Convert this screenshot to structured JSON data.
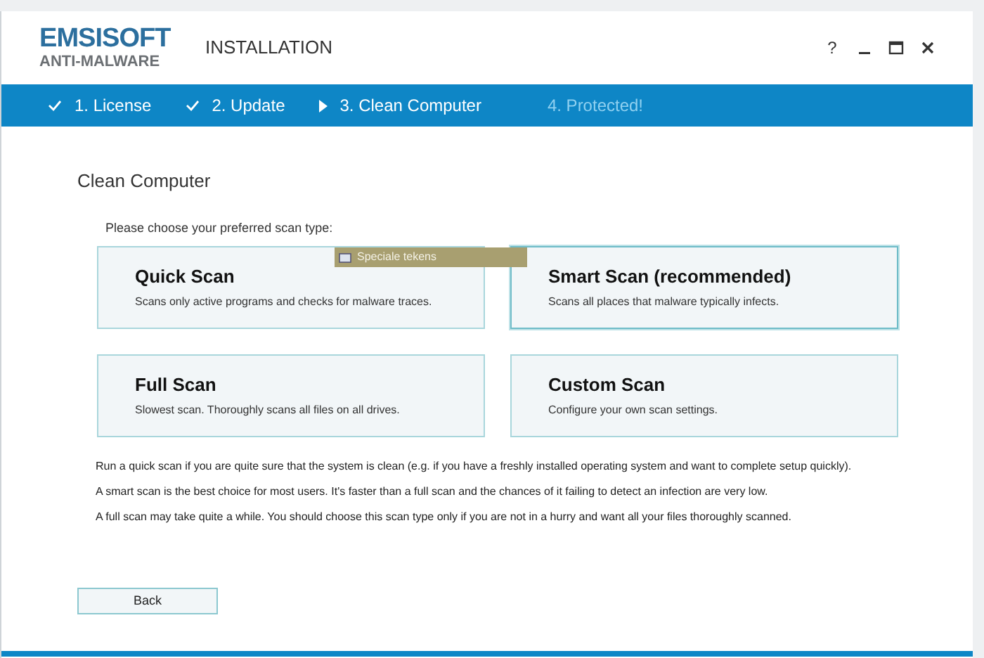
{
  "window": {
    "logo_top": "EMSISOFT",
    "logo_bottom": "ANTI-MALWARE",
    "title": "INSTALLATION",
    "help": "?"
  },
  "steps": [
    {
      "label": "1. License",
      "kind": "done"
    },
    {
      "label": "2. Update",
      "kind": "done"
    },
    {
      "label": "3. Clean Computer",
      "kind": "current"
    },
    {
      "label": "4. Protected!",
      "kind": "pending"
    }
  ],
  "heading": "Clean Computer",
  "prompt": "Please choose your preferred scan type:",
  "scan_options": [
    {
      "title": "Quick Scan",
      "description": "Scans only active programs and checks for malware traces.",
      "selected": false
    },
    {
      "title": "Smart Scan (recommended)",
      "description": "Scans all places that malware typically infects.",
      "selected": true
    },
    {
      "title": "Full Scan",
      "description": "Slowest scan. Thoroughly scans all files on all drives.",
      "selected": false
    },
    {
      "title": "Custom Scan",
      "description": "Configure your own scan settings.",
      "selected": false
    }
  ],
  "notes": [
    "Run a quick scan if you are quite sure that the system is clean (e.g. if you have a freshly installed operating system and want to complete setup quickly).",
    "A smart scan is the best choice for most users. It's faster than a full scan and the chances of it failing to detect an infection are very low.",
    "A full scan may take quite a while. You should choose this scan type only if you are not in a hurry and want all your files thoroughly scanned."
  ],
  "tooltip": "Speciale tekens",
  "back_button": "Back"
}
